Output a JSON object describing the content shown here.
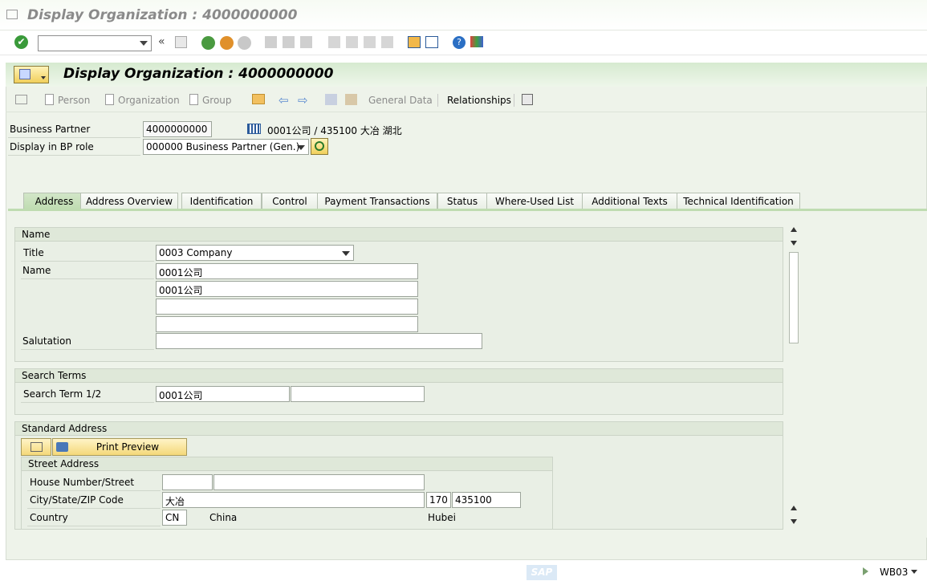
{
  "window": {
    "title": "Display Organization : 4000000000"
  },
  "header": {
    "title": "Display Organization : 4000000000"
  },
  "appbar": {
    "person": "Person",
    "organization": "Organization",
    "group": "Group",
    "general_data": "General Data",
    "relationships": "Relationships"
  },
  "bp": {
    "business_partner_label": "Business Partner",
    "business_partner_value": "4000000000",
    "partner_desc": "0001公司 / 435100 大冶 湖北",
    "role_label": "Display in BP role",
    "role_value": "000000 Business Partner (Gen.)"
  },
  "tabs": [
    {
      "label": "Address"
    },
    {
      "label": "Address Overview"
    },
    {
      "label": "Identification"
    },
    {
      "label": "Control"
    },
    {
      "label": "Payment Transactions"
    },
    {
      "label": "Status"
    },
    {
      "label": "Where-Used List"
    },
    {
      "label": "Additional Texts"
    },
    {
      "label": "Technical Identification"
    }
  ],
  "name_group": {
    "header": "Name",
    "title_label": "Title",
    "title_value": "0003 Company",
    "name_label": "Name",
    "name1": "0001公司",
    "name2": "0001公司",
    "name3": "",
    "name4": "",
    "salutation_label": "Salutation",
    "salutation_value": ""
  },
  "search_group": {
    "header": "Search Terms",
    "label": "Search Term 1/2",
    "term1": "0001公司",
    "term2": ""
  },
  "address_group": {
    "header": "Standard Address",
    "print_preview": "Print Preview",
    "street_header": "Street Address",
    "house_label": "House Number/Street",
    "house_no": "",
    "street": "",
    "city_label": "City/State/ZIP Code",
    "city": "大冶",
    "state": "170",
    "zip": "435100",
    "country_label": "Country",
    "country_code": "CN",
    "country_name": "China",
    "region_name": "Hubei"
  },
  "status": {
    "system": "WB03"
  },
  "brand": {
    "logo": "SAP"
  },
  "colors": {
    "accent": "#bfdcb1",
    "header": "#d6ead0",
    "button": "#f4d879"
  }
}
